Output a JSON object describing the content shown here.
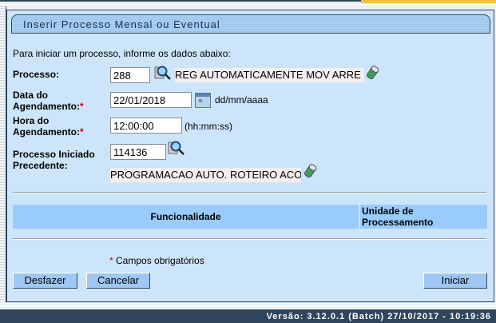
{
  "title": "Inserir Processo Mensal ou Eventual",
  "intro": "Para iniciar um processo, informe os dados abaixo:",
  "form": {
    "processo": {
      "label": "Processo:",
      "value": "288",
      "description": "REG AUTOMATICAMENTE MOV ARRE"
    },
    "data": {
      "label_line1": "Data do",
      "label_line2": "Agendamento:",
      "required": "*",
      "value": "22/01/2018",
      "hint": "dd/mm/aaaa"
    },
    "hora": {
      "label_line1": "Hora do",
      "label_line2": "Agendamento:",
      "required": "*",
      "value": "12:00:00",
      "hint": "(hh:mm:ss)"
    },
    "precedente": {
      "label_line1": "Processo Iniciado",
      "label_line2": "Precedente:",
      "value": "114136",
      "description": "PROGRAMACAO AUTO. ROTEIRO ACOMPANHAMENTO"
    }
  },
  "table": {
    "headers": [
      "Funcionalidade",
      "Unidade de Processamento"
    ]
  },
  "required_note": {
    "star": "*",
    "text": " Campos obrigatórios"
  },
  "buttons": {
    "undo": "Desfazer",
    "cancel": "Cancelar",
    "start": "Iniciar"
  },
  "footer": "Versão: 3.12.0.1 (Batch) 27/10/2017 - 10:19:36",
  "icons": {
    "search": "magnifier-icon",
    "clear": "eraser-icon",
    "calendar": "calendar-icon"
  }
}
